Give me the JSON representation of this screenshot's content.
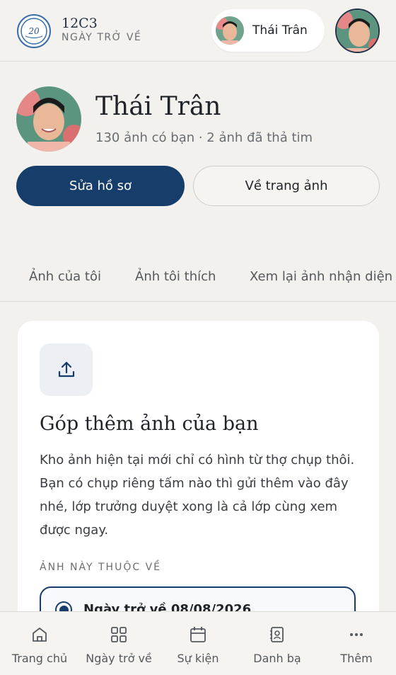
{
  "header": {
    "brand_title": "12C3",
    "brand_subtitle": "NGÀY TRỞ VỀ",
    "user_pill_name": "Thái Trân"
  },
  "profile": {
    "name": "Thái Trân",
    "stats": "130 ảnh có bạn · 2 ảnh đã thả tim",
    "edit_button": "Sửa hồ sơ",
    "gallery_button": "Về trang ảnh"
  },
  "tabs": [
    {
      "label": "Ảnh của tôi"
    },
    {
      "label": "Ảnh tôi thích"
    },
    {
      "label": "Xem lại ảnh nhận diện"
    }
  ],
  "upload_card": {
    "title": "Góp thêm ảnh của bạn",
    "description": "Kho ảnh hiện tại mới chỉ có hình từ thợ chụp thôi. Bạn có chụp riêng tấm nào thì gửi thêm vào đây nhé, lớp trưởng duyệt xong là cả lớp cùng xem được ngay.",
    "section_label": "ẢNH NÀY THUỘC VỀ",
    "selected_option": "Ngày trở về 08/08/2026"
  },
  "bottom_nav": [
    {
      "label": "Trang chủ",
      "icon": "home-icon"
    },
    {
      "label": "Ngày trở về",
      "icon": "grid-icon"
    },
    {
      "label": "Sự kiện",
      "icon": "calendar-icon"
    },
    {
      "label": "Danh bạ",
      "icon": "contacts-icon"
    },
    {
      "label": "Thêm",
      "icon": "more-icon"
    }
  ],
  "colors": {
    "primary": "#173e6b",
    "background": "#f2f1ee",
    "card": "#ffffff"
  }
}
